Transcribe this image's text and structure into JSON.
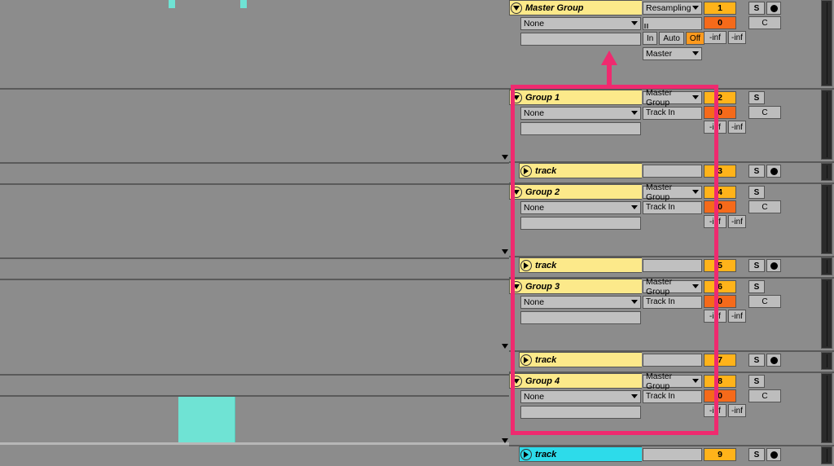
{
  "master": {
    "title": "Master Group",
    "midi_from": "None",
    "audio_to": "Resampling",
    "monitor_in": "In",
    "monitor_auto": "Auto",
    "monitor_off": "Off",
    "output": "Master",
    "num": "1",
    "send": "0",
    "solo": "S",
    "c": "C",
    "inf1": "-inf",
    "inf2": "-inf"
  },
  "groups": [
    {
      "title": "Group 1",
      "midi_from": "None",
      "route": "Master Group",
      "sub": "Track In",
      "num": "2",
      "send": "0",
      "solo": "S",
      "c": "C",
      "inf1": "-inf",
      "inf2": "-inf",
      "child": {
        "title": "track",
        "num": "3",
        "solo": "S",
        "has_rec": true
      }
    },
    {
      "title": "Group 2",
      "midi_from": "None",
      "route": "Master Group",
      "sub": "Track In",
      "num": "4",
      "send": "0",
      "solo": "S",
      "c": "C",
      "inf1": "-inf",
      "inf2": "-inf",
      "child": {
        "title": "track",
        "num": "5",
        "solo": "S",
        "has_rec": true
      }
    },
    {
      "title": "Group 3",
      "midi_from": "None",
      "route": "Master Group",
      "sub": "Track In",
      "num": "6",
      "send": "0",
      "solo": "S",
      "c": "C",
      "inf1": "-inf",
      "inf2": "-inf",
      "child": {
        "title": "track",
        "num": "7",
        "solo": "S",
        "has_rec": true
      }
    },
    {
      "title": "Group 4",
      "midi_from": "None",
      "route": "Master Group",
      "sub": "Track In",
      "num": "8",
      "send": "0",
      "solo": "S",
      "c": "C",
      "inf1": "-inf",
      "inf2": "-inf",
      "child": {
        "title": "track",
        "num": "9",
        "solo": "S",
        "has_rec": true,
        "cyan": true
      }
    }
  ],
  "labels": {
    "record_arm": "●"
  }
}
